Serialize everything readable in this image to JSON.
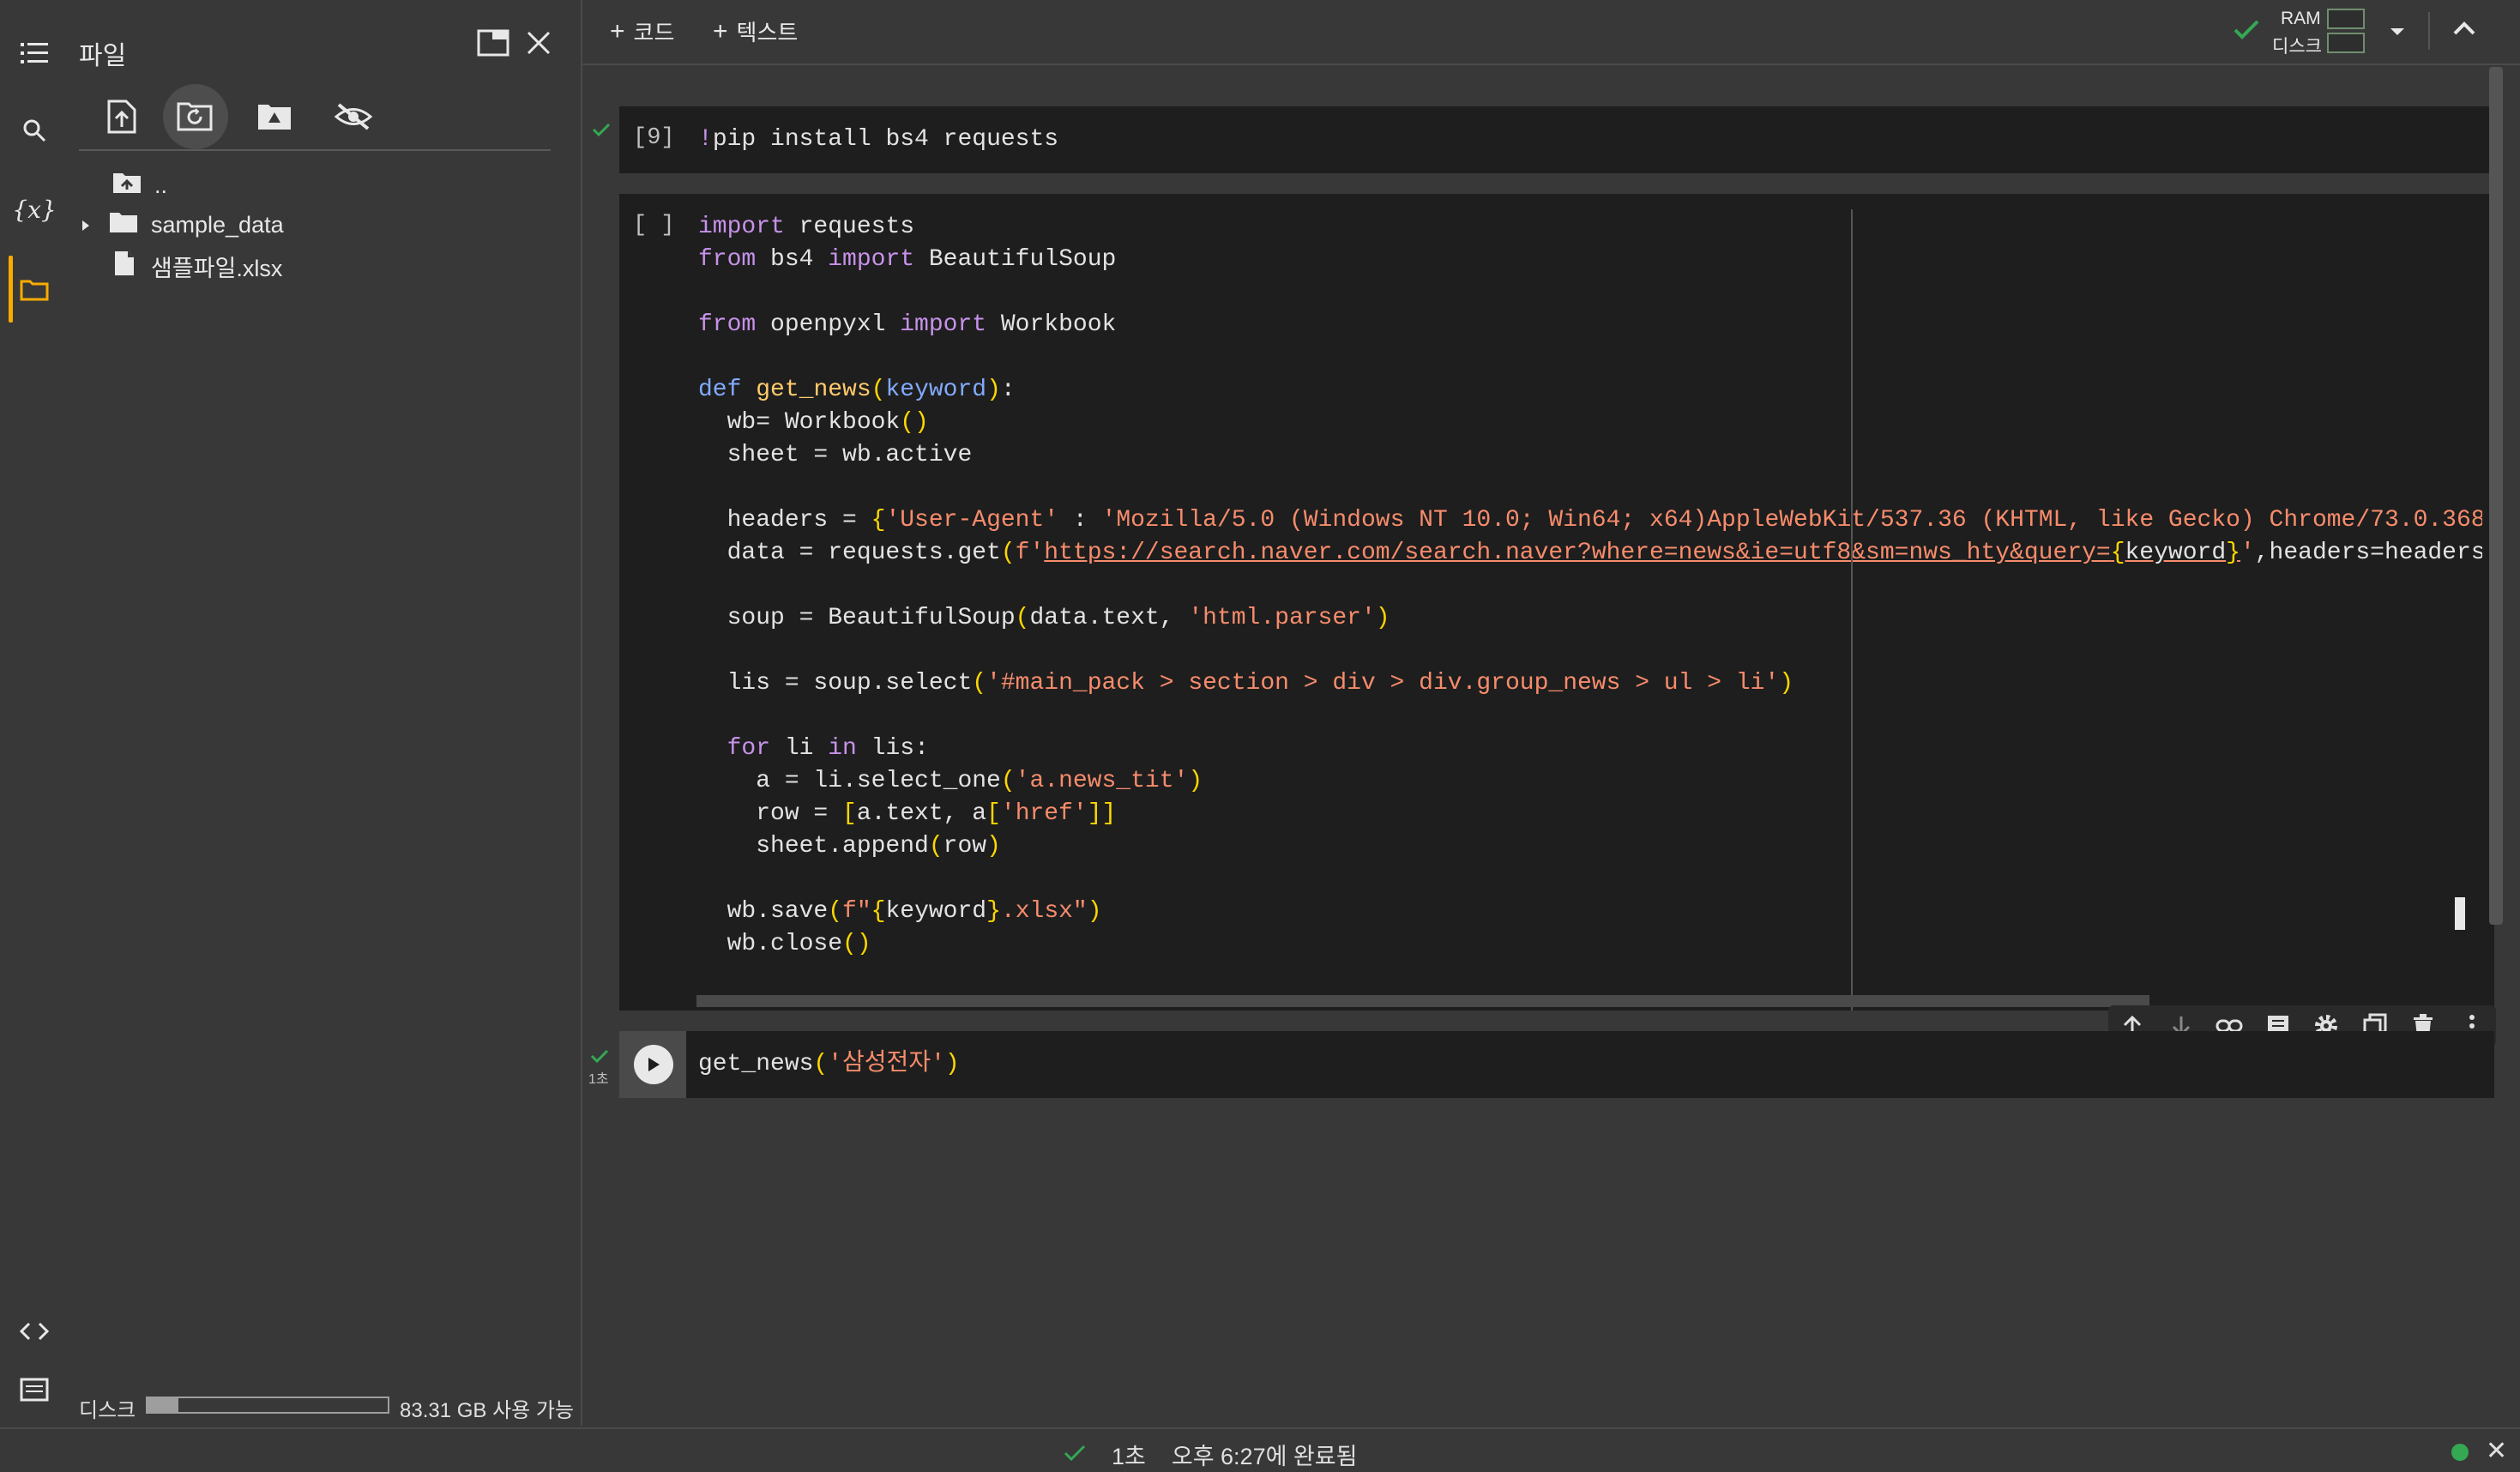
{
  "files_panel": {
    "title": "파일",
    "tree": [
      {
        "label": ".."
      },
      {
        "label": "sample_data"
      },
      {
        "label": "샘플파일.xlsx"
      }
    ],
    "disk_label": "디스크",
    "disk_free": "83.31 GB 사용 가능",
    "disk_used_fraction": 0.13
  },
  "toolbar": {
    "add_code": "코드",
    "add_text": "텍스트",
    "ram_label": "RAM",
    "disk_label": "디스크"
  },
  "cells": {
    "cell1": {
      "count": "[9]",
      "code": "!pip install bs4 requests"
    },
    "cell2": {
      "count": "[ ]"
    },
    "cell3": {
      "time": "1초",
      "code_fn": "get_news",
      "code_arg": "'삼성전자'"
    }
  },
  "status": {
    "duration": "1초",
    "completed": "오후 6:27에 완료됨"
  },
  "colors": {
    "background": "#383838",
    "cell_background": "#1e1e1e",
    "success_green": "#34a853",
    "accent_orange": "#f9ab00"
  }
}
